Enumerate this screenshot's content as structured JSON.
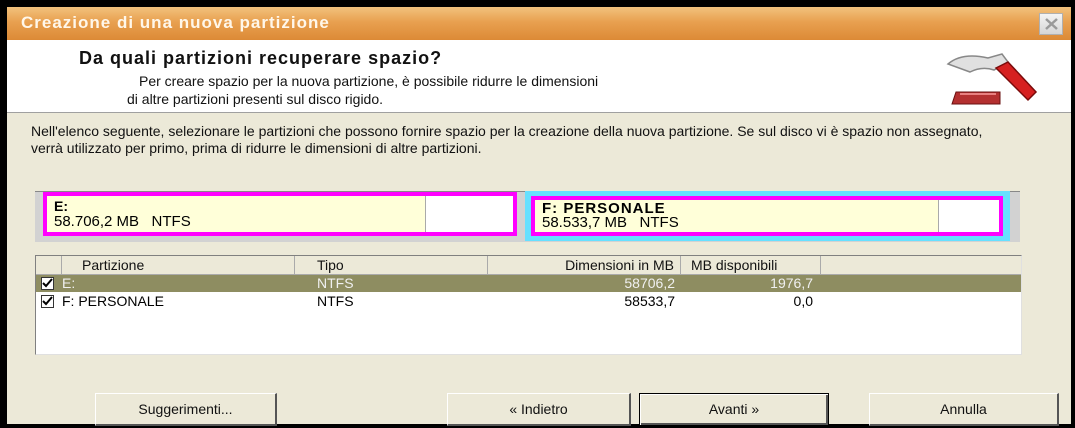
{
  "window": {
    "title": "Creazione di una nuova partizione",
    "close_icon": "close-icon"
  },
  "header": {
    "title": "Da quali partizioni recuperare spazio?",
    "subtitle_line1": "Per creare spazio per la nuova partizione, è possibile ridurre le dimensioni",
    "subtitle_line2": "di altre partizioni presenti sul disco rigido.",
    "icon": "hammer-icon"
  },
  "description": "Nell'elenco seguente, selezionare le partizioni che possono fornire spazio per la creazione della nuova partizione. Se sul disco vi è spazio non assegnato, verrà utilizzato per primo, prima di ridurre le dimensioni di altre partizioni.",
  "disk_map": [
    {
      "name": "E:",
      "size": "58.706,2 MB   NTFS",
      "selected": false
    },
    {
      "name": "F:  PERSONALE",
      "size": "58.533,7 MB   NTFS",
      "selected": true
    }
  ],
  "table": {
    "columns": [
      "Partizione",
      "Tipo",
      "Dimensioni in MB",
      "MB disponibili"
    ],
    "rows": [
      {
        "checked": true,
        "partition": "E:",
        "type": "NTFS",
        "size": "58706,2",
        "available": "1976,7",
        "selected": true
      },
      {
        "checked": true,
        "partition": "F: PERSONALE",
        "type": "NTFS",
        "size": "58533,7",
        "available": "0,0",
        "selected": false
      }
    ]
  },
  "buttons": {
    "hints": "Suggerimenti...",
    "back": "« Indietro",
    "next": "Avanti »",
    "cancel": "Annulla"
  },
  "colors": {
    "titlebar": "#e8a050",
    "partition_border": "#ff00ff",
    "partition_selected_outline": "#66e0ff",
    "partition_fill": "#ffffd9",
    "row_selected": "#8e8d61"
  }
}
